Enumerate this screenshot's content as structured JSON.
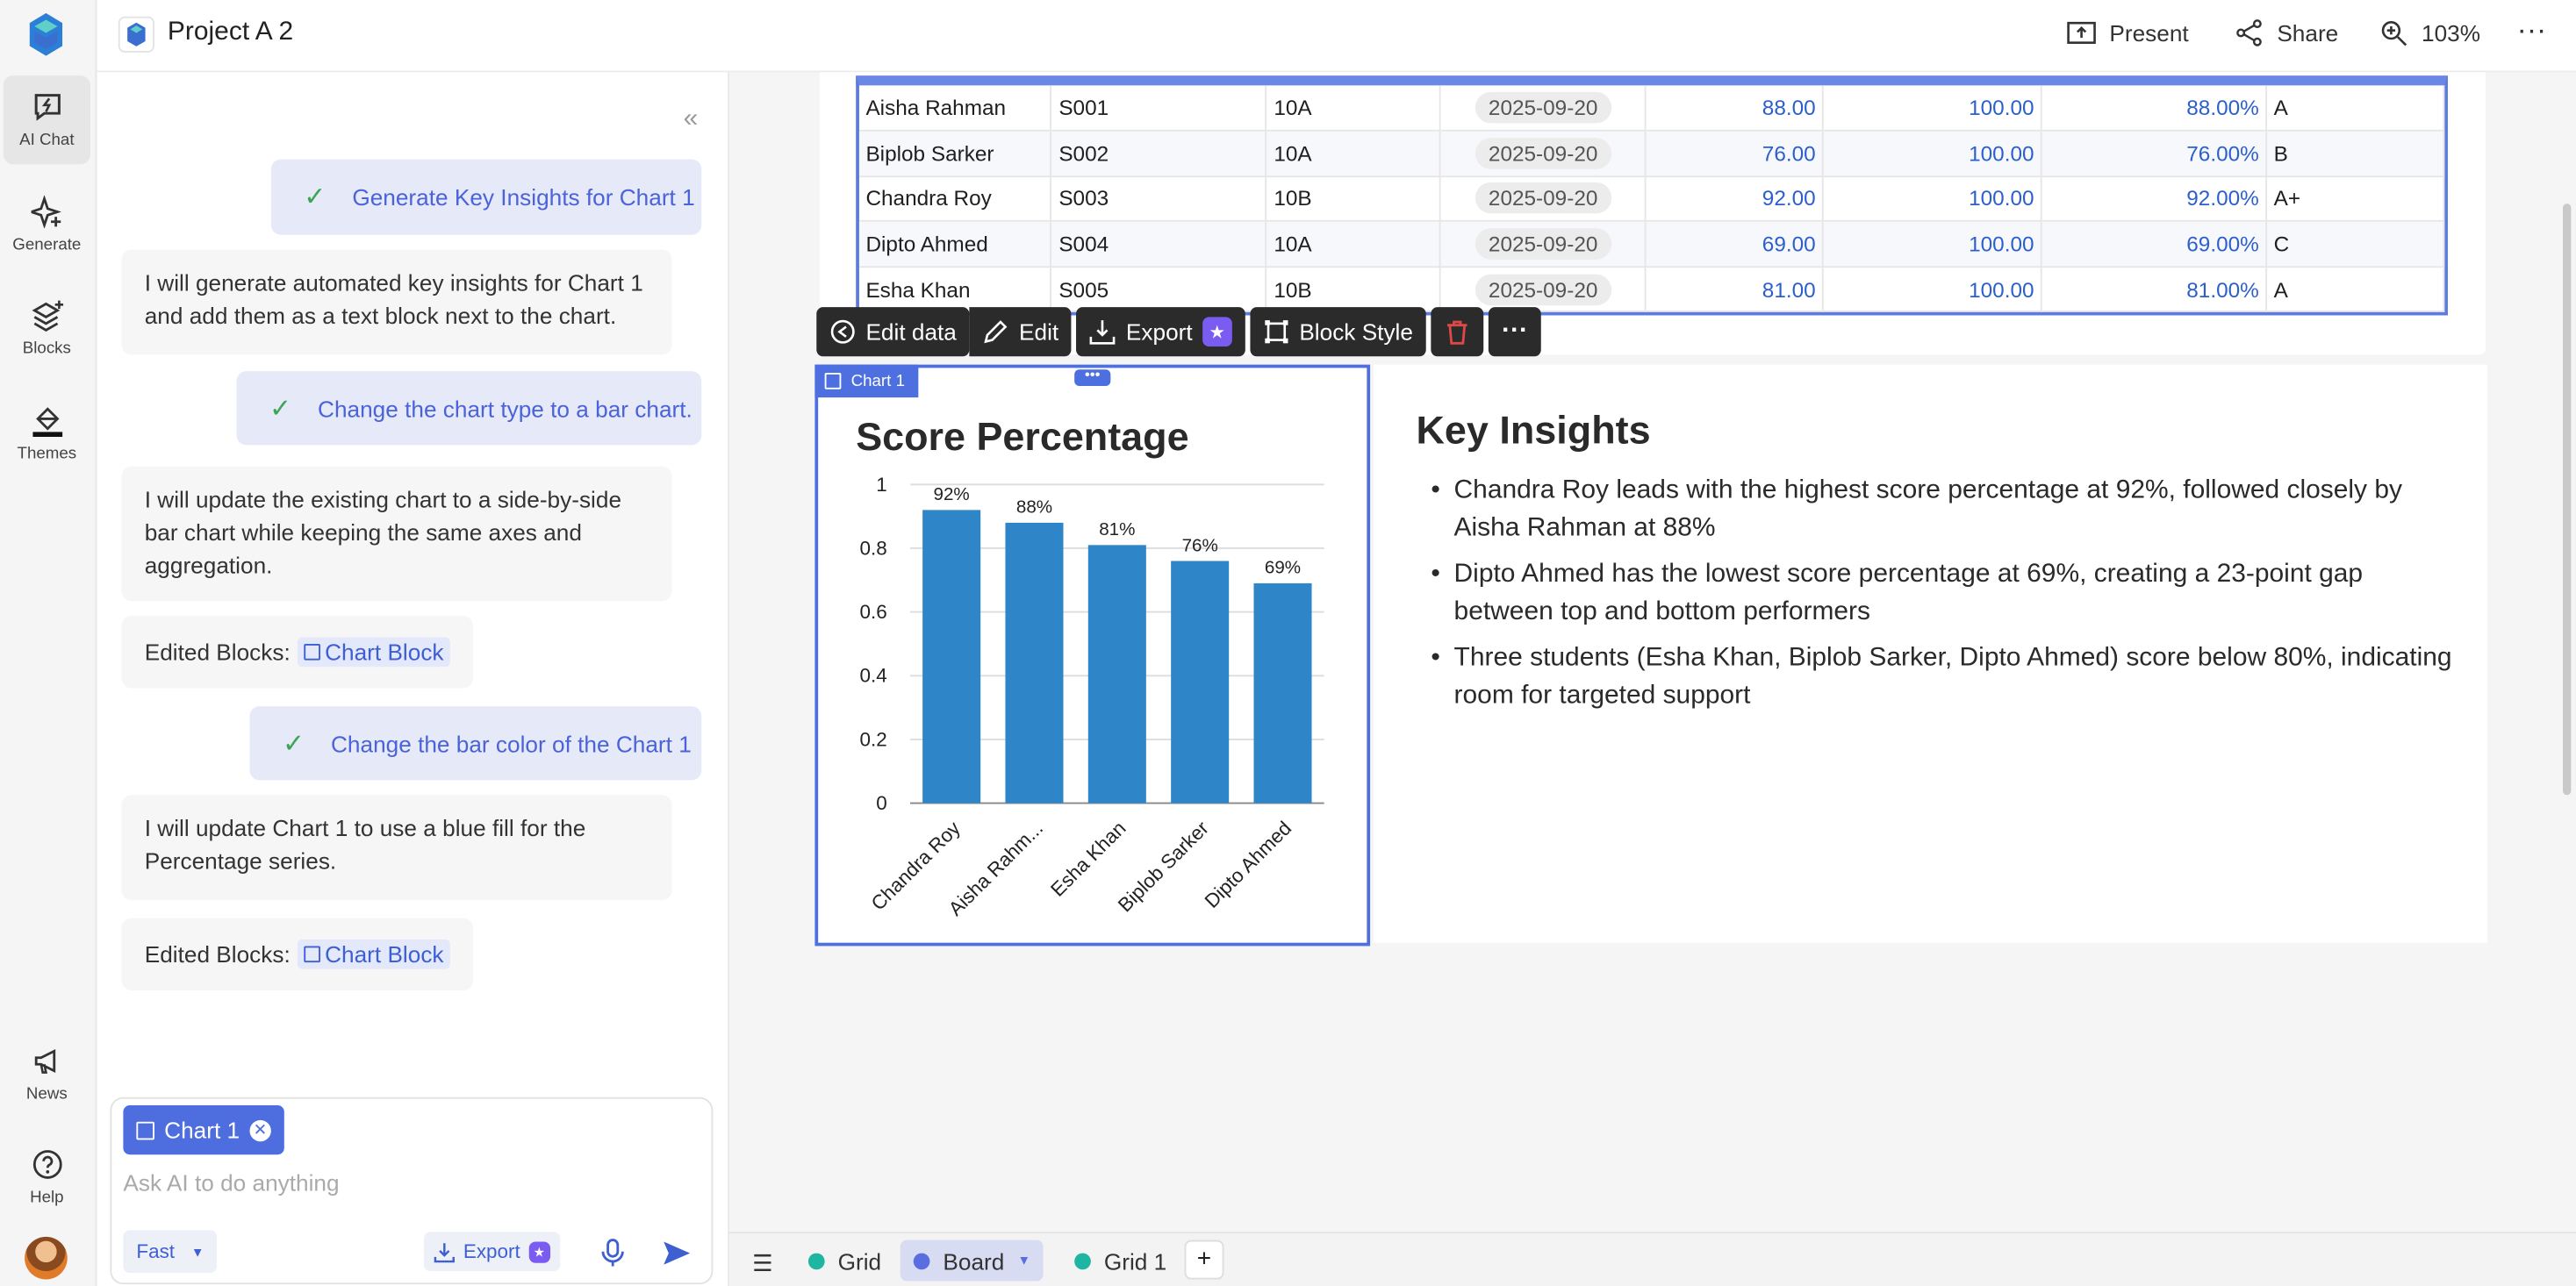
{
  "rail": {
    "items": [
      {
        "label": "AI Chat"
      },
      {
        "label": "Generate"
      },
      {
        "label": "Blocks"
      },
      {
        "label": "Themes"
      },
      {
        "label": "News"
      },
      {
        "label": "Help"
      }
    ]
  },
  "topbar": {
    "project_title": "Project A 2",
    "present_label": "Present",
    "share_label": "Share",
    "zoom_label": "103%"
  },
  "chat": {
    "messages": [
      {
        "role": "user",
        "text": "Generate Key Insights for Chart 1"
      },
      {
        "role": "assistant",
        "text": "I will generate automated key insights for Chart 1 and add them as a text block next to the chart."
      },
      {
        "role": "user",
        "text": "Change the chart type to a bar chart."
      },
      {
        "role": "assistant",
        "text": "I will update the existing chart to a side-by-side bar chart while keeping the same axes and aggregation."
      },
      {
        "role": "edited",
        "prefix": "Edited Blocks:",
        "chip": "Chart Block"
      },
      {
        "role": "user",
        "text": "Change the bar color of the Chart 1"
      },
      {
        "role": "assistant",
        "text": "I will update Chart 1 to use a blue fill for the Percentage series."
      },
      {
        "role": "edited",
        "prefix": "Edited Blocks:",
        "chip": "Chart Block"
      }
    ],
    "composer": {
      "context_chip": "Chart 1",
      "placeholder": "Ask AI to do anything",
      "mode": "Fast",
      "export_label": "Export"
    }
  },
  "table": {
    "rows": [
      [
        "Aisha Rahman",
        "S001",
        "10A",
        "2025-09-20",
        "88.00",
        "100.00",
        "88.00%",
        "A"
      ],
      [
        "Biplob Sarker",
        "S002",
        "10A",
        "2025-09-20",
        "76.00",
        "100.00",
        "76.00%",
        "B"
      ],
      [
        "Chandra Roy",
        "S003",
        "10B",
        "2025-09-20",
        "92.00",
        "100.00",
        "92.00%",
        "A+"
      ],
      [
        "Dipto Ahmed",
        "S004",
        "10A",
        "2025-09-20",
        "69.00",
        "100.00",
        "69.00%",
        "C"
      ],
      [
        "Esha Khan",
        "S005",
        "10B",
        "2025-09-20",
        "81.00",
        "100.00",
        "81.00%",
        "A"
      ]
    ]
  },
  "block_toolbar": {
    "edit_data": "Edit data",
    "edit": "Edit",
    "export": "Export",
    "block_style": "Block Style"
  },
  "chart_block": {
    "tag": "Chart 1"
  },
  "chart_data": {
    "type": "bar",
    "title": "Score Percentage",
    "categories": [
      "Chandra Roy",
      "Aisha Rahm...",
      "Esha Khan",
      "Biplob Sarker",
      "Dipto Ahmed"
    ],
    "values": [
      0.92,
      0.88,
      0.81,
      0.76,
      0.69
    ],
    "data_labels": [
      "92%",
      "88%",
      "81%",
      "76%",
      "69%"
    ],
    "y_ticks": [
      "0",
      "0.2",
      "0.4",
      "0.6",
      "0.8",
      "1"
    ],
    "ylim": [
      0,
      1
    ],
    "bar_color": "#2e86c8",
    "grid": true
  },
  "insights": {
    "title": "Key Insights",
    "items": [
      "Chandra Roy leads with the highest score percentage at 92%, followed closely by Aisha Rahman at 88%",
      "Dipto Ahmed has the lowest score percentage at 69%, creating a 23-point gap between top and bottom performers",
      "Three students (Esha Khan, Biplob Sarker, Dipto Ahmed) score below 80%, indicating room for targeted support"
    ]
  },
  "sheets": {
    "tabs": [
      {
        "label": "Grid",
        "color": "#1fb5a3"
      },
      {
        "label": "Board",
        "color": "#5b6ee0"
      },
      {
        "label": "Grid 1",
        "color": "#1fb5a3"
      }
    ],
    "add_label": "+"
  }
}
